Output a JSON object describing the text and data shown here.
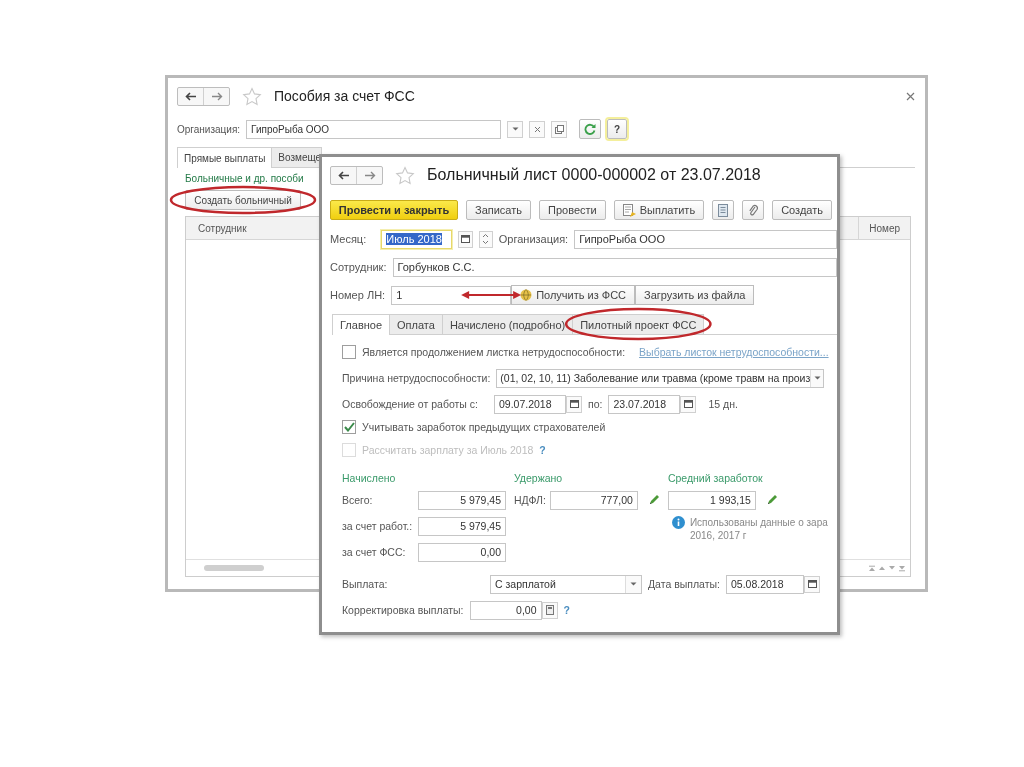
{
  "back_window": {
    "title": "Пособия за счет ФСС",
    "organization": {
      "label": "Организация:",
      "value": "ГипроРыба ООО"
    },
    "help": "?",
    "tabs": [
      {
        "label": "Прямые выплаты",
        "selected": true
      },
      {
        "label": "Возмеще",
        "selected": false
      }
    ],
    "group_title": "Больничные и др. пособи",
    "create_button": "Создать больничный",
    "table": {
      "columns": [
        "Сотрудник",
        "Номер"
      ]
    }
  },
  "document": {
    "title": "Больничный лист 0000-000002 от 23.07.2018",
    "toolbar": [
      {
        "kind": "default",
        "label": "Провести и закрыть"
      },
      {
        "kind": "plain",
        "label": "Записать"
      },
      {
        "kind": "plain",
        "label": "Провести"
      },
      {
        "kind": "pay",
        "label": "Выплатить"
      },
      {
        "kind": "report"
      },
      {
        "kind": "attach"
      },
      {
        "kind": "plain",
        "label": "Создать"
      }
    ],
    "month": {
      "label": "Месяц:",
      "value": "Июль 2018",
      "text_selected": true
    },
    "organization": {
      "label": "Организация:",
      "value": "ГипроРыба ООО"
    },
    "employee": {
      "label": "Сотрудник:",
      "value": "Горбунков С.С."
    },
    "sick_leave_number": {
      "label": "Номер ЛН:",
      "value": "1"
    },
    "fss_buttons": [
      {
        "kind": "fetch",
        "label": "Получить из ФСС"
      },
      {
        "kind": "plain",
        "label": "Загрузить из файла"
      }
    ],
    "tabs": [
      {
        "label": "Главное",
        "selected": true
      },
      {
        "label": "Оплата",
        "selected": false
      },
      {
        "label": "Начислено (подробно)",
        "selected": false
      },
      {
        "label": "Пилотный проект ФСС",
        "selected": false
      }
    ],
    "continuation": {
      "label": "Является продолжением листка нетрудоспособности:",
      "checked": false,
      "disabled": false,
      "link": "Выбрать листок нетрудоспособности..."
    },
    "reason": {
      "label": "Причина нетрудоспособности:",
      "value": "(01, 02, 10, 11) Заболевание или травма (кроме травм на произ"
    },
    "release": {
      "label": "Освобождение от работы с:",
      "from": "09.07.2018",
      "to_label": "по:",
      "to": "23.07.2018",
      "days": "15 дн."
    },
    "prev_employers": {
      "label": "Учитывать заработок предыдущих страхователей",
      "checked": true,
      "disabled": false
    },
    "recalc": {
      "label": "Рассчитать зарплату за Июль 2018",
      "checked": false,
      "disabled": true,
      "help": "?"
    },
    "accrued": {
      "title": "Начислено",
      "rows": [
        {
          "label": "Всего:",
          "value": "5 979,45"
        },
        {
          "label": "за счет работ.:",
          "value": "5 979,45"
        },
        {
          "label": "за счет ФСС:",
          "value": "0,00"
        }
      ]
    },
    "withheld": {
      "title": "Удержано",
      "label": "НДФЛ:",
      "value": "777,00"
    },
    "average": {
      "title": "Средний заработок",
      "value": "1 993,15",
      "note": [
        "Использованы данные о зара",
        "2016,  2017 г"
      ]
    },
    "payment": {
      "label": "Выплата:",
      "value": "С зарплатой",
      "date_label": "Дата выплаты:",
      "date": "05.08.2018"
    },
    "correction": {
      "label": "Корректировка выплаты:",
      "value": "0,00",
      "help": "?"
    }
  }
}
